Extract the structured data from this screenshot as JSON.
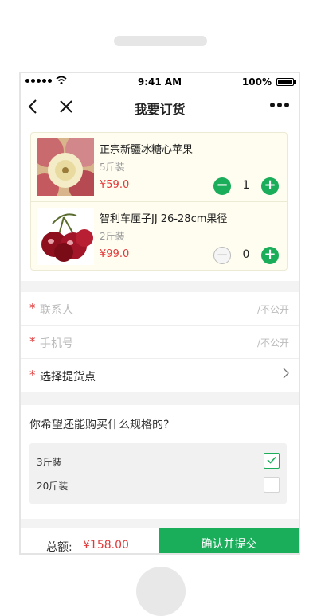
{
  "status_bar": {
    "time": "9:41 AM",
    "battery": "100%",
    "signal_icon": "signal-dots-icon",
    "wifi_icon": "wifi-icon"
  },
  "nav": {
    "title": "我要订货",
    "back_icon": "back-chevron-icon",
    "close_icon": "close-icon",
    "more_icon": "more-dots-icon"
  },
  "products": [
    {
      "name": "正宗新疆冰糖心苹果",
      "spec": "5斤装",
      "price": "¥59.0",
      "quantity": "1",
      "image": "apple-image"
    },
    {
      "name": "智利车厘子JJ 26-28cm果径",
      "spec": "2斤装",
      "price": "¥99.0",
      "quantity": "0",
      "image": "cherry-image"
    }
  ],
  "form": {
    "contact_label": "联系人",
    "contact_hint": "/不公开",
    "phone_label": "手机号",
    "phone_hint": "/不公开",
    "pickup_label": "选择提货点",
    "required_mark": "*"
  },
  "question": {
    "title": "你希望还能购买什么规格的?",
    "options": [
      {
        "label": "3斤装",
        "checked": true
      },
      {
        "label": "20斤装",
        "checked": false
      }
    ]
  },
  "footer": {
    "total_label": "总额:",
    "total_value": "¥158.00",
    "submit_label": "确认并提交"
  },
  "colors": {
    "accent_green": "#1aad5a",
    "price_red": "#e23a3a"
  }
}
